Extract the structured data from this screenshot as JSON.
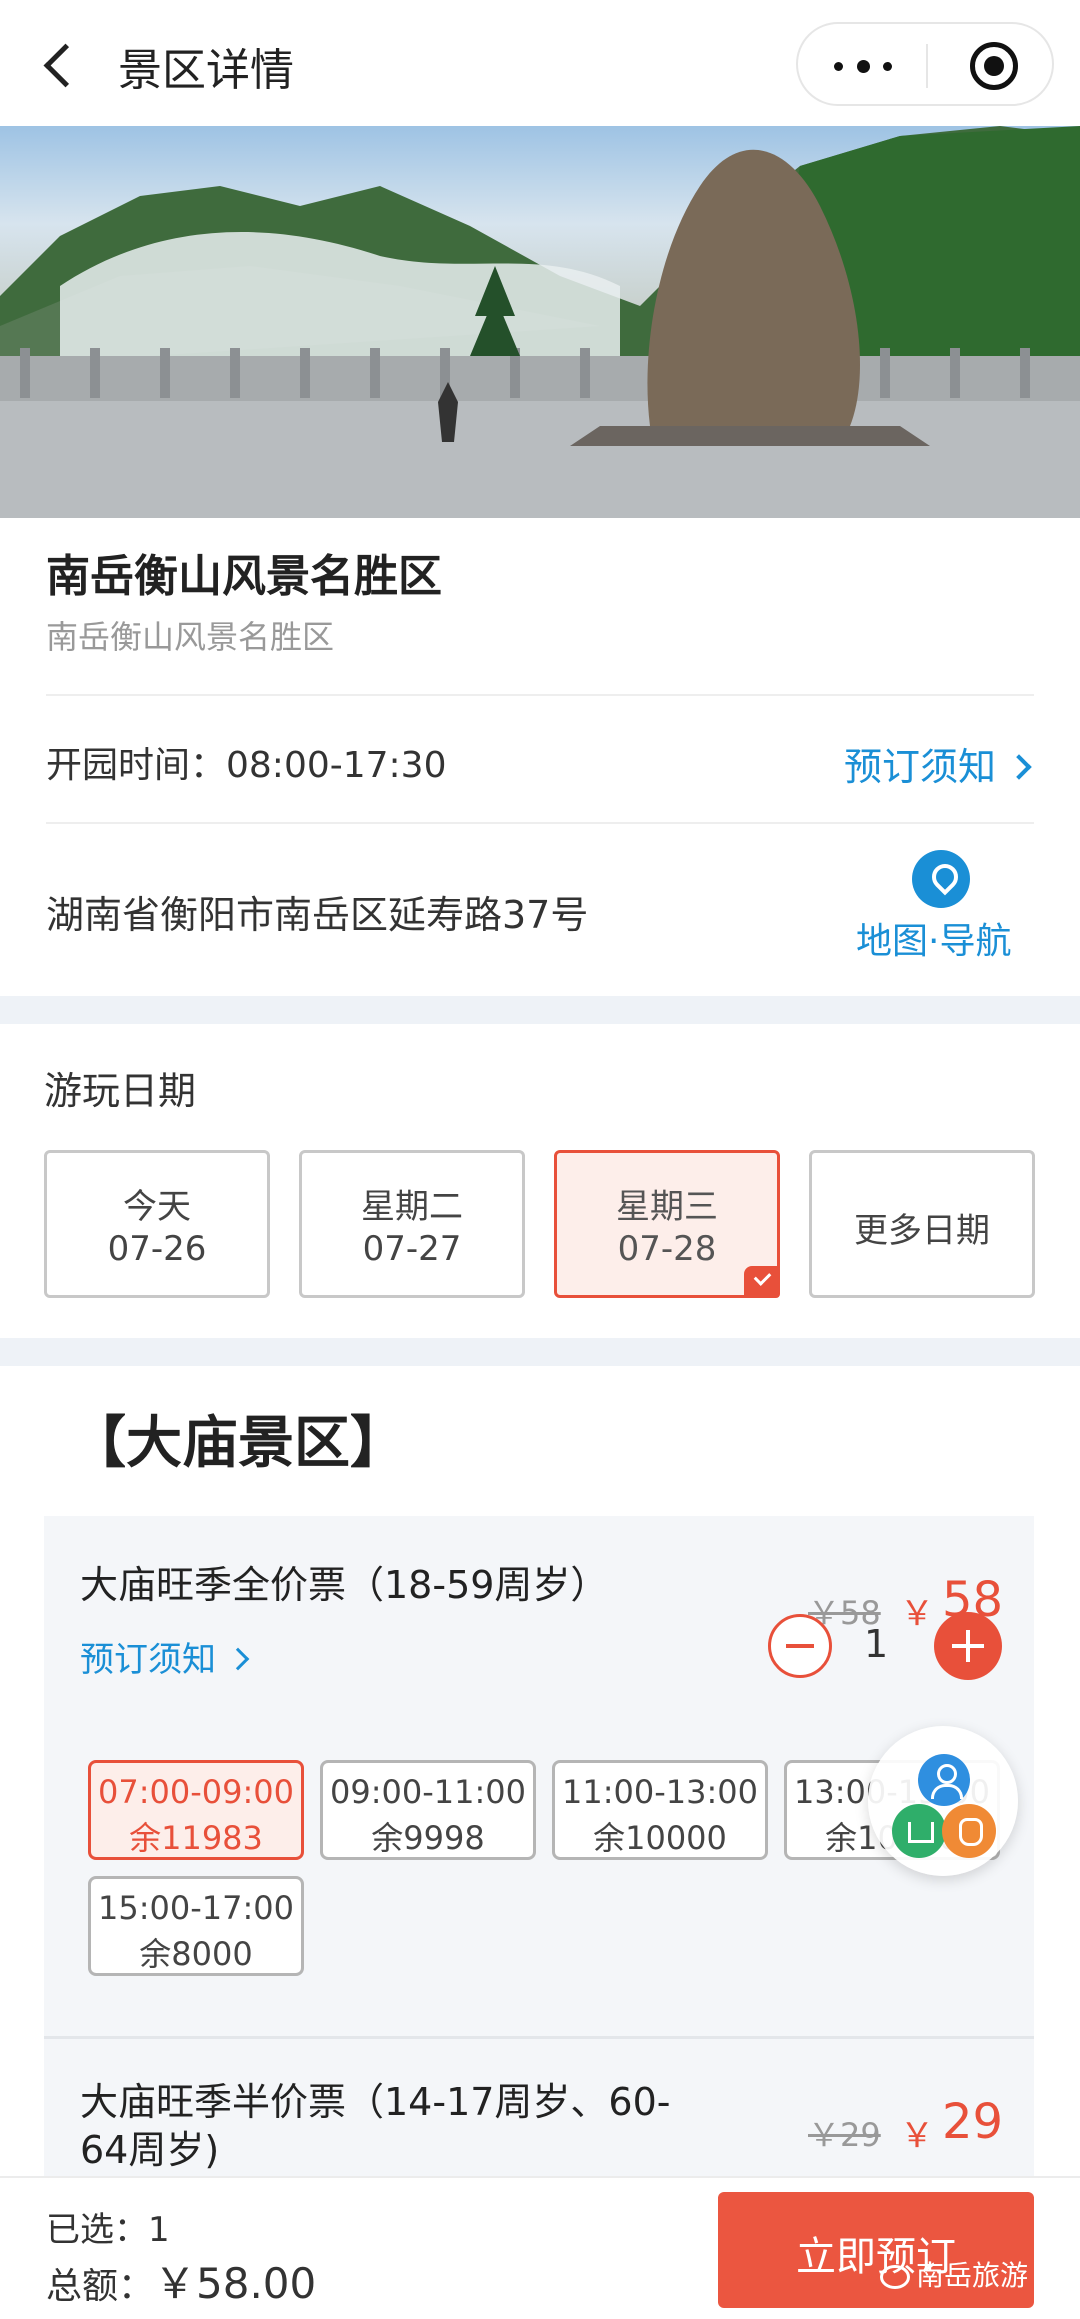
{
  "header": {
    "title": "景区详情"
  },
  "scenic": {
    "name": "南岳衡山风景名胜区",
    "subtitle": "南岳衡山风景名胜区",
    "open_time": "开园时间：08:00-17:30",
    "notice_link": "预订须知",
    "address": "湖南省衡阳市南岳区延寿路37号",
    "map_nav": "地图·导航"
  },
  "dates": {
    "label": "游玩日期",
    "items": [
      {
        "line1": "今天",
        "line2": "07-26",
        "selected": false
      },
      {
        "line1": "星期二",
        "line2": "07-27",
        "selected": false
      },
      {
        "line1": "星期三",
        "line2": "07-28",
        "selected": true
      }
    ],
    "more": "更多日期"
  },
  "area": {
    "title": "【大庙景区】"
  },
  "tickets": [
    {
      "name": "大庙旺季全价票（18-59周岁）",
      "original_price": "￥58",
      "currency": "￥",
      "price": "58",
      "notice": "预订须知",
      "quantity": "1",
      "slots": [
        {
          "time": "07:00-09:00",
          "remain": "余11983",
          "active": true
        },
        {
          "time": "09:00-11:00",
          "remain": "余9998",
          "active": false
        },
        {
          "time": "11:00-13:00",
          "remain": "余10000",
          "active": false
        },
        {
          "time": "13:00-15:00",
          "remain": "余10000",
          "active": false
        },
        {
          "time": "15:00-17:00",
          "remain": "余8000",
          "active": false
        }
      ]
    },
    {
      "name": "大庙旺季半价票（14-17周岁、60-64周岁)",
      "original_price": "￥29",
      "currency": "￥",
      "price": "29"
    }
  ],
  "bottom": {
    "selected": "已选：1",
    "total_label": "总额：",
    "total_amount": "￥58.00",
    "book_button": "立即预订",
    "watermark": "南岳旅游"
  },
  "colors": {
    "accent": "#e8503a",
    "link": "#1a8fd6"
  }
}
